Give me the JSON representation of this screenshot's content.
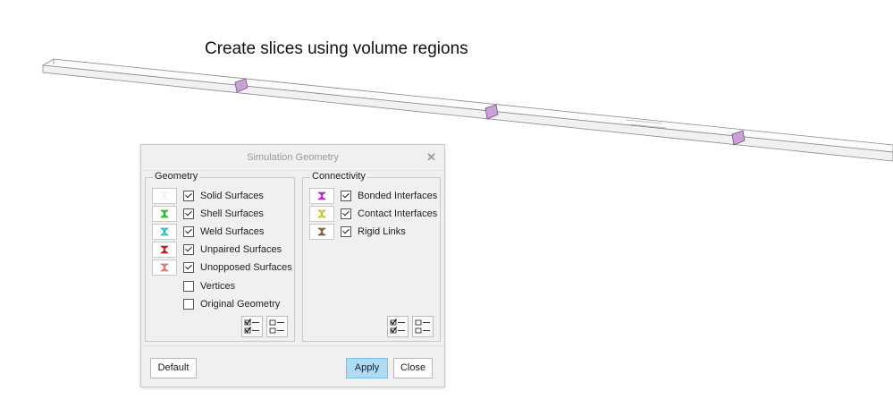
{
  "caption": "Create slices using volume regions",
  "dialog": {
    "title": "Simulation Geometry",
    "close_symbol": "✕",
    "geometry": {
      "title": "Geometry",
      "items": [
        {
          "label": "Solid Surfaces",
          "checked": true,
          "color": "#ffffff",
          "icon": "solid-surfaces-icon"
        },
        {
          "label": "Shell Surfaces",
          "checked": true,
          "color": "#22e022",
          "icon": "shell-surfaces-icon"
        },
        {
          "label": "Weld Surfaces",
          "checked": true,
          "color": "#2ee8ee",
          "icon": "weld-surfaces-icon"
        },
        {
          "label": "Unpaired Surfaces",
          "checked": true,
          "color": "#e81818",
          "icon": "unpaired-surfaces-icon"
        },
        {
          "label": "Unopposed Surfaces",
          "checked": true,
          "color": "#f08a8a",
          "icon": "unopposed-surfaces-icon"
        },
        {
          "label": "Vertices",
          "checked": false
        },
        {
          "label": "Original Geometry",
          "checked": false
        }
      ]
    },
    "connectivity": {
      "title": "Connectivity",
      "items": [
        {
          "label": "Bonded Interfaces",
          "checked": true,
          "color": "#e820e8",
          "icon": "bonded-interfaces-icon"
        },
        {
          "label": "Contact Interfaces",
          "checked": true,
          "color": "#f0f020",
          "icon": "contact-interfaces-icon"
        },
        {
          "label": "Rigid Links",
          "checked": true,
          "color": "#a0683a",
          "icon": "rigid-links-icon"
        }
      ]
    },
    "buttons": {
      "default_label": "Default",
      "apply_label": "Apply",
      "close_label": "Close"
    }
  }
}
